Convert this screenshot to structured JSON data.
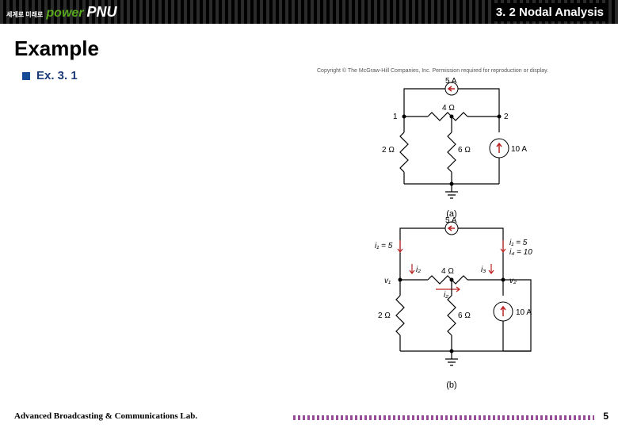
{
  "header": {
    "small": "세계로 미래로",
    "power": "power",
    "pnu": "PNU",
    "section": "3. 2 Nodal Analysis"
  },
  "title": "Example",
  "subtitle": "Ex. 3. 1",
  "copyright": "Copyright © The McGraw-Hill Companies, Inc. Permission required for reproduction or display.",
  "circuit_a": {
    "src_top": "5 A",
    "r_top": "4 Ω",
    "node1": "1",
    "node2": "2",
    "r_left": "2 Ω",
    "r_mid": "6 Ω",
    "src_right": "10 A",
    "caption": "(a)"
  },
  "circuit_b": {
    "src_top": "5 A",
    "i1": "i₁ = 5",
    "i1r": "i₁ = 5",
    "i4": "i₄ = 10",
    "i2": "i₂",
    "i3": "i₃",
    "i2b": "i₂",
    "v1": "v₁",
    "v2": "v₂",
    "r_top": "4 Ω",
    "r_left": "2 Ω",
    "r_mid": "6 Ω",
    "src_right": "10 A",
    "caption": "(b)"
  },
  "footer": {
    "lab": "Advanced Broadcasting & Communications Lab.",
    "page": "5"
  }
}
